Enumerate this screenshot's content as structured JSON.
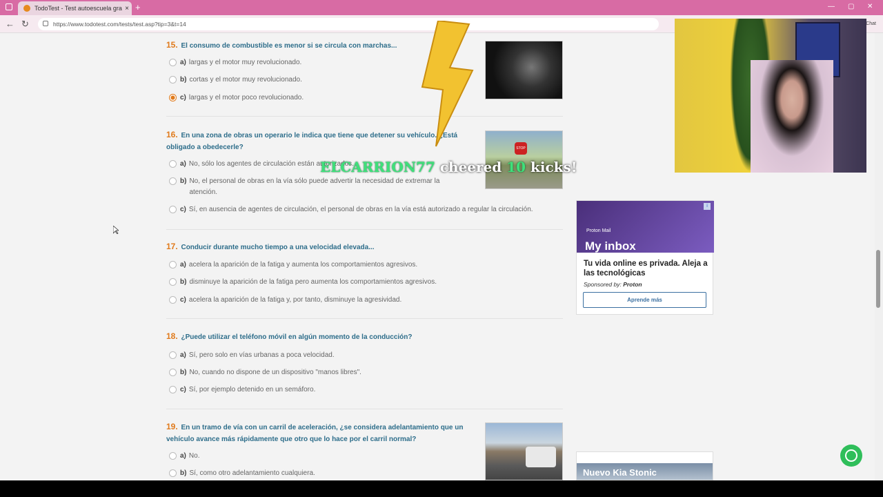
{
  "browser": {
    "tab_title": "TodoTest - Test autoescuela gratis",
    "tab_close": "×",
    "new_tab": "+",
    "url": "https://www.todotest.com/tests/test.asp?tip=3&t=14",
    "right_label": "Chat"
  },
  "questions": [
    {
      "number": "15.",
      "text": "El consumo de combustible es menor si se circula con marchas...",
      "options": [
        {
          "letter": "a)",
          "text": "largas y el motor muy revolucionado.",
          "selected": false
        },
        {
          "letter": "b)",
          "text": "cortas y el motor muy revolucionado.",
          "selected": false
        },
        {
          "letter": "c)",
          "text": "largas y el motor poco revolucionado.",
          "selected": true
        }
      ]
    },
    {
      "number": "16.",
      "text": "En una zona de obras un operario le indica que tiene que detener su vehículo. ¿Está obligado a obedecerle?",
      "options": [
        {
          "letter": "a)",
          "text": "No, sólo los agentes de circulación están autorizados.",
          "selected": false
        },
        {
          "letter": "b)",
          "text": "No, el personal de obras en la vía sólo puede advertir la necesidad de extremar la atención.",
          "selected": false
        },
        {
          "letter": "c)",
          "text": "Sí, en ausencia de agentes de circulación, el personal de obras en la vía está autorizado a regular la circulación.",
          "selected": false
        }
      ]
    },
    {
      "number": "17.",
      "text": "Conducir durante mucho tiempo a una velocidad elevada...",
      "options": [
        {
          "letter": "a)",
          "text": "acelera la aparición de la fatiga y aumenta los comportamientos agresivos.",
          "selected": false
        },
        {
          "letter": "b)",
          "text": "disminuye la aparición de la fatiga pero aumenta los comportamientos agresivos.",
          "selected": false
        },
        {
          "letter": "c)",
          "text": "acelera la aparición de la fatiga y, por tanto, disminuye la agresividad.",
          "selected": false
        }
      ]
    },
    {
      "number": "18.",
      "text": "¿Puede utilizar el teléfono móvil en algún momento de la conducción?",
      "options": [
        {
          "letter": "a)",
          "text": "Sí, pero solo en vías urbanas a poca velocidad.",
          "selected": false
        },
        {
          "letter": "b)",
          "text": "No, cuando no dispone de un dispositivo \"manos libres\".",
          "selected": false
        },
        {
          "letter": "c)",
          "text": "Sí, por ejemplo detenido en un semáforo.",
          "selected": false
        }
      ]
    },
    {
      "number": "19.",
      "text": "En un tramo de vía con un carril de aceleración, ¿se considera adelantamiento que un vehículo avance más rápidamente que otro que lo hace por el carril normal?",
      "options": [
        {
          "letter": "a)",
          "text": "No.",
          "selected": false
        },
        {
          "letter": "b)",
          "text": "Sí, como otro adelantamiento cualquiera.",
          "selected": false
        }
      ]
    }
  ],
  "ad": {
    "brand": "Proton Mail",
    "headline_img": "My inbox",
    "title": "Tu vida online es privada. Aleja a las tecnológicas",
    "sponsor_prefix": "Sponsored by:",
    "sponsor": "Proton",
    "button": "Aprende más"
  },
  "ad2": {
    "text": "Nuevo Kia Stonic"
  },
  "overlay": {
    "user": "ELCARRION77",
    "middle": "cheered",
    "count": "10",
    "suffix": "kicks!"
  },
  "colors": {
    "accent": "#e07a1b",
    "question": "#2d6d8a",
    "tabbar": "#d86ba4",
    "alert_green": "#3ee07a"
  }
}
